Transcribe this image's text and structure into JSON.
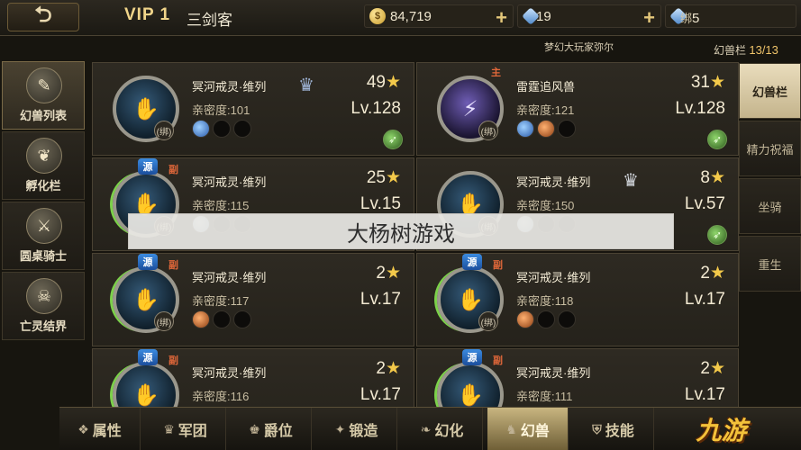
{
  "header": {
    "back_icon": "back-arrow-icon",
    "vip_label": "VIP 1",
    "player_name": "三剑客",
    "gold": {
      "icon": "gold-coin-icon",
      "value": "84,719",
      "add_label": "+"
    },
    "diamond": {
      "icon": "blue-diamond-icon",
      "value": "19",
      "add_label": "+"
    },
    "bound_diamond": {
      "icon": "bound-diamond-icon",
      "prefix": "绑",
      "value": "5"
    }
  },
  "subheader": {
    "broadcast": "梦幻大玩家弥尔",
    "slot_label": "幻兽栏",
    "slot_count": "13/13"
  },
  "left_nav": [
    {
      "label": "幻兽列表",
      "icon": "scroll-icon",
      "glyph": "✎",
      "active": true
    },
    {
      "label": "孵化栏",
      "icon": "rooster-icon",
      "glyph": "❦",
      "active": false
    },
    {
      "label": "圆桌骑士",
      "icon": "round-table-icon",
      "glyph": "⚔",
      "active": false
    },
    {
      "label": "亡灵结界",
      "icon": "skull-icon",
      "glyph": "☠",
      "active": false
    }
  ],
  "right_nav": [
    {
      "label": "幻兽栏",
      "active": true
    },
    {
      "label": "精力祝福",
      "active": false
    },
    {
      "label": "坐骑",
      "active": false
    },
    {
      "label": "重生",
      "active": false
    }
  ],
  "cards": [
    {
      "name": "冥河戒灵·维列",
      "intimacy_label": "亲密度:",
      "intimacy": "101",
      "stars": "49",
      "level": "Lv.128",
      "bound": "(绑)",
      "role": "",
      "source": "",
      "crown": "blue",
      "gems": [
        "blue",
        "empty",
        "empty"
      ],
      "portrait_icon": "wraith-icon",
      "action": true
    },
    {
      "name": "雷霆追风兽",
      "intimacy_label": "亲密度:",
      "intimacy": "121",
      "stars": "31",
      "level": "Lv.128",
      "bound": "(绑)",
      "role": "主",
      "source": "",
      "crown": "",
      "gems": [
        "blue",
        "orange",
        "empty"
      ],
      "portrait_icon": "thunder-beast-icon",
      "action": true
    },
    {
      "name": "冥河戒灵·维列",
      "intimacy_label": "亲密度:",
      "intimacy": "115",
      "stars": "25",
      "level": "Lv.15",
      "bound": "(绑)",
      "role": "副",
      "source": "源",
      "crown": "",
      "gems": [
        "light",
        "empty",
        "empty"
      ],
      "portrait_icon": "wraith-icon",
      "action": false
    },
    {
      "name": "冥河戒灵·维列",
      "intimacy_label": "亲密度:",
      "intimacy": "150",
      "stars": "8",
      "level": "Lv.57",
      "bound": "(绑)",
      "role": "",
      "source": "",
      "crown": "silver",
      "gems": [
        "light",
        "empty",
        "empty"
      ],
      "portrait_icon": "wraith-icon",
      "action": true
    },
    {
      "name": "冥河戒灵·维列",
      "intimacy_label": "亲密度:",
      "intimacy": "117",
      "stars": "2",
      "level": "Lv.17",
      "bound": "(绑)",
      "role": "副",
      "source": "源",
      "crown": "",
      "gems": [
        "orange",
        "empty",
        "empty"
      ],
      "portrait_icon": "wraith-icon",
      "action": false
    },
    {
      "name": "冥河戒灵·维列",
      "intimacy_label": "亲密度:",
      "intimacy": "118",
      "stars": "2",
      "level": "Lv.17",
      "bound": "(绑)",
      "role": "副",
      "source": "源",
      "crown": "",
      "gems": [
        "orange",
        "empty",
        "empty"
      ],
      "portrait_icon": "wraith-icon",
      "action": false
    },
    {
      "name": "冥河戒灵·维列",
      "intimacy_label": "亲密度:",
      "intimacy": "116",
      "stars": "2",
      "level": "Lv.17",
      "bound": "(绑)",
      "role": "副",
      "source": "源",
      "crown": "",
      "gems": [],
      "portrait_icon": "wraith-icon",
      "action": false
    },
    {
      "name": "冥河戒灵·维列",
      "intimacy_label": "亲密度:",
      "intimacy": "111",
      "stars": "2",
      "level": "Lv.17",
      "bound": "(绑)",
      "role": "副",
      "source": "源",
      "crown": "",
      "gems": [],
      "portrait_icon": "wraith-icon",
      "action": false
    }
  ],
  "watermark": "大杨树游戏",
  "bottom_tabs": [
    {
      "label": "属性",
      "icon": "attribute-icon",
      "glyph": "❖",
      "active": false
    },
    {
      "label": "军团",
      "icon": "legion-icon",
      "glyph": "♛",
      "active": false
    },
    {
      "label": "爵位",
      "icon": "title-icon",
      "glyph": "♚",
      "active": false
    },
    {
      "label": "锻造",
      "icon": "forge-icon",
      "glyph": "✦",
      "active": false
    },
    {
      "label": "幻化",
      "icon": "transform-icon",
      "glyph": "❧",
      "active": false
    },
    {
      "label": "幻兽",
      "icon": "beast-icon",
      "glyph": "♞",
      "active": true
    },
    {
      "label": "技能",
      "icon": "skill-icon",
      "glyph": "⛨",
      "active": false
    }
  ],
  "site_logo": "九游"
}
